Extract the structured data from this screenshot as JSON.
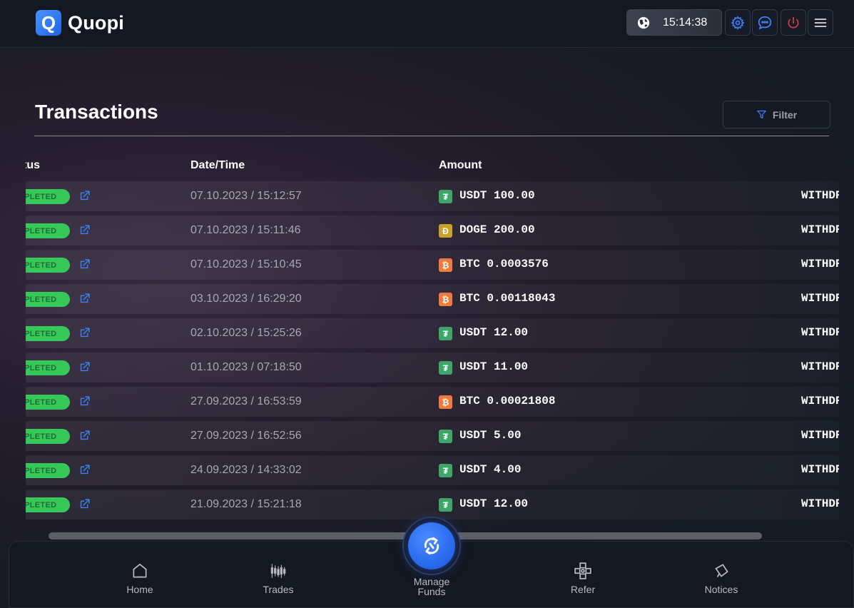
{
  "header": {
    "logo_letter": "Q",
    "app_name": "Quopi",
    "clock_time": "15:14:38"
  },
  "page": {
    "title": "Transactions",
    "filter_label": "Filter"
  },
  "table": {
    "columns": [
      "tus",
      "Date/Time",
      "Amount"
    ],
    "rows": [
      {
        "status": "MPLETED",
        "datetime": "07.10.2023 / 15:12:57",
        "coin": "usdt",
        "amount": "USDT 100.00",
        "type": "WITHDR"
      },
      {
        "status": "MPLETED",
        "datetime": "07.10.2023 / 15:11:46",
        "coin": "doge",
        "amount": "DOGE 200.00",
        "type": "WITHDR"
      },
      {
        "status": "MPLETED",
        "datetime": "07.10.2023 / 15:10:45",
        "coin": "btc",
        "amount": "BTC 0.0003576",
        "type": "WITHDR"
      },
      {
        "status": "MPLETED",
        "datetime": "03.10.2023 / 16:29:20",
        "coin": "btc",
        "amount": "BTC 0.00118043",
        "type": "WITHDR"
      },
      {
        "status": "MPLETED",
        "datetime": "02.10.2023 / 15:25:26",
        "coin": "usdt",
        "amount": "USDT 12.00",
        "type": "WITHDR"
      },
      {
        "status": "MPLETED",
        "datetime": "01.10.2023 / 07:18:50",
        "coin": "usdt",
        "amount": "USDT 11.00",
        "type": "WITHDR"
      },
      {
        "status": "MPLETED",
        "datetime": "27.09.2023 / 16:53:59",
        "coin": "btc",
        "amount": "BTC 0.00021808",
        "type": "WITHDR"
      },
      {
        "status": "MPLETED",
        "datetime": "27.09.2023 / 16:52:56",
        "coin": "usdt",
        "amount": "USDT 5.00",
        "type": "WITHDR"
      },
      {
        "status": "MPLETED",
        "datetime": "24.09.2023 / 14:33:02",
        "coin": "usdt",
        "amount": "USDT 4.00",
        "type": "WITHDR"
      },
      {
        "status": "MPLETED",
        "datetime": "21.09.2023 / 15:21:18",
        "coin": "usdt",
        "amount": "USDT 12.00",
        "type": "WITHDR"
      }
    ]
  },
  "coins": {
    "usdt": {
      "glyph": "₮",
      "color": "#3fa66a"
    },
    "doge": {
      "glyph": "Ð",
      "color": "#c9a22b"
    },
    "btc": {
      "glyph": "₿",
      "color": "#f07a3e"
    }
  },
  "bottom_nav": {
    "home": "Home",
    "trades": "Trades",
    "manage_funds_line1": "Manage",
    "manage_funds_line2": "Funds",
    "refer": "Refer",
    "notices": "Notices"
  },
  "colors": {
    "accent": "#2a6bef",
    "status_completed": "#37c85a",
    "link": "#3b82f6"
  }
}
